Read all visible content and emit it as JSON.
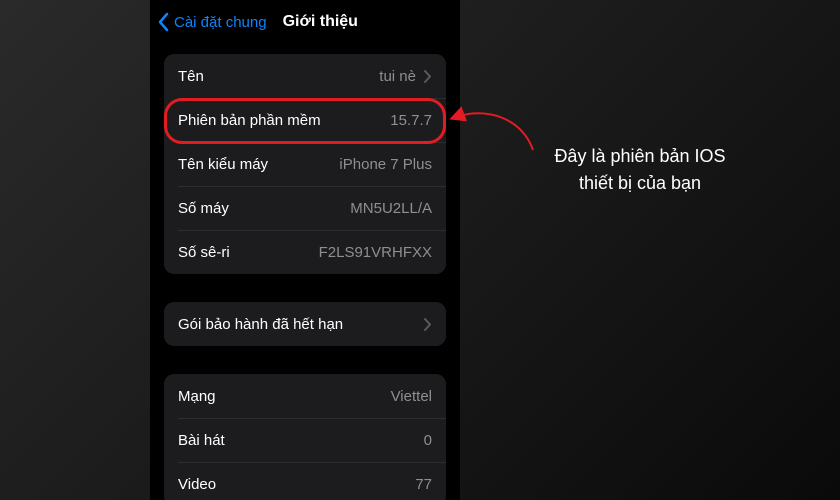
{
  "navbar": {
    "back_label": "Cài đặt chung",
    "title": "Giới thiệu"
  },
  "group1": [
    {
      "label": "Tên",
      "value": "tui nè",
      "chevron": true
    },
    {
      "label": "Phiên bản phần mềm",
      "value": "15.7.7",
      "chevron": false
    },
    {
      "label": "Tên kiểu máy",
      "value": "iPhone 7 Plus",
      "chevron": false
    },
    {
      "label": "Số máy",
      "value": "MN5U2LL/A",
      "chevron": false
    },
    {
      "label": "Số sê-ri",
      "value": "F2LS91VRHFXX",
      "chevron": false
    }
  ],
  "group2": [
    {
      "label": "Gói bảo hành đã hết hạn",
      "value": "",
      "chevron": true
    }
  ],
  "group3": [
    {
      "label": "Mạng",
      "value": "Viettel",
      "chevron": false
    },
    {
      "label": "Bài hát",
      "value": "0",
      "chevron": false
    },
    {
      "label": "Video",
      "value": "77",
      "chevron": false
    }
  ],
  "annotation": {
    "line1": "Đây là phiên bản IOS",
    "line2": "thiết bị của bạn"
  }
}
